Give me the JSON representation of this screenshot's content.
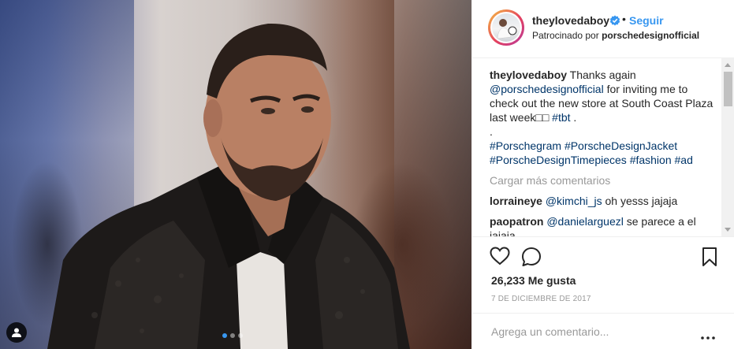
{
  "post": {
    "username": "theylovedaboy",
    "follow_label": "Seguir",
    "separator": "•",
    "sponsored_prefix": "Patrocinado por",
    "sponsor": "porschedesignofficial",
    "caption": {
      "user": "theylovedaboy",
      "part1": " Thanks again ",
      "mention": "@porschedesignofficial",
      "part2": " for inviting me to check out the new store at South Coast Plaza last week□□ ",
      "tag": "#tbt",
      "part3": " .",
      "dot": ".",
      "hashtags": [
        "#Porschegram",
        "#PorscheDesignJacket",
        "#PorscheDesignTimepieces",
        "#fashion",
        "#ad"
      ]
    },
    "load_more": "Cargar más comentarios",
    "comments": [
      {
        "user": "lorraineye",
        "mention": "@kimchi_js",
        "text": " oh yesss jajaja"
      },
      {
        "user": "paopatron",
        "mention": "@danielarguezl",
        "text": " se parece a el jajaja"
      }
    ],
    "likes": "26,233 Me gusta",
    "date": "7 DE DICIEMBRE DE 2017",
    "comment_placeholder": "Agrega un comentario...",
    "more_label": "•••"
  },
  "colors": {
    "link": "#003569",
    "follow": "#3897f0",
    "muted": "#999999",
    "text": "#262626",
    "verified": "#3897f0"
  },
  "icons": [
    "verified-badge-icon",
    "heart-icon",
    "comment-icon",
    "bookmark-icon",
    "more-icon",
    "user-tag-icon"
  ],
  "carousel": {
    "count": 3,
    "active": 1
  }
}
